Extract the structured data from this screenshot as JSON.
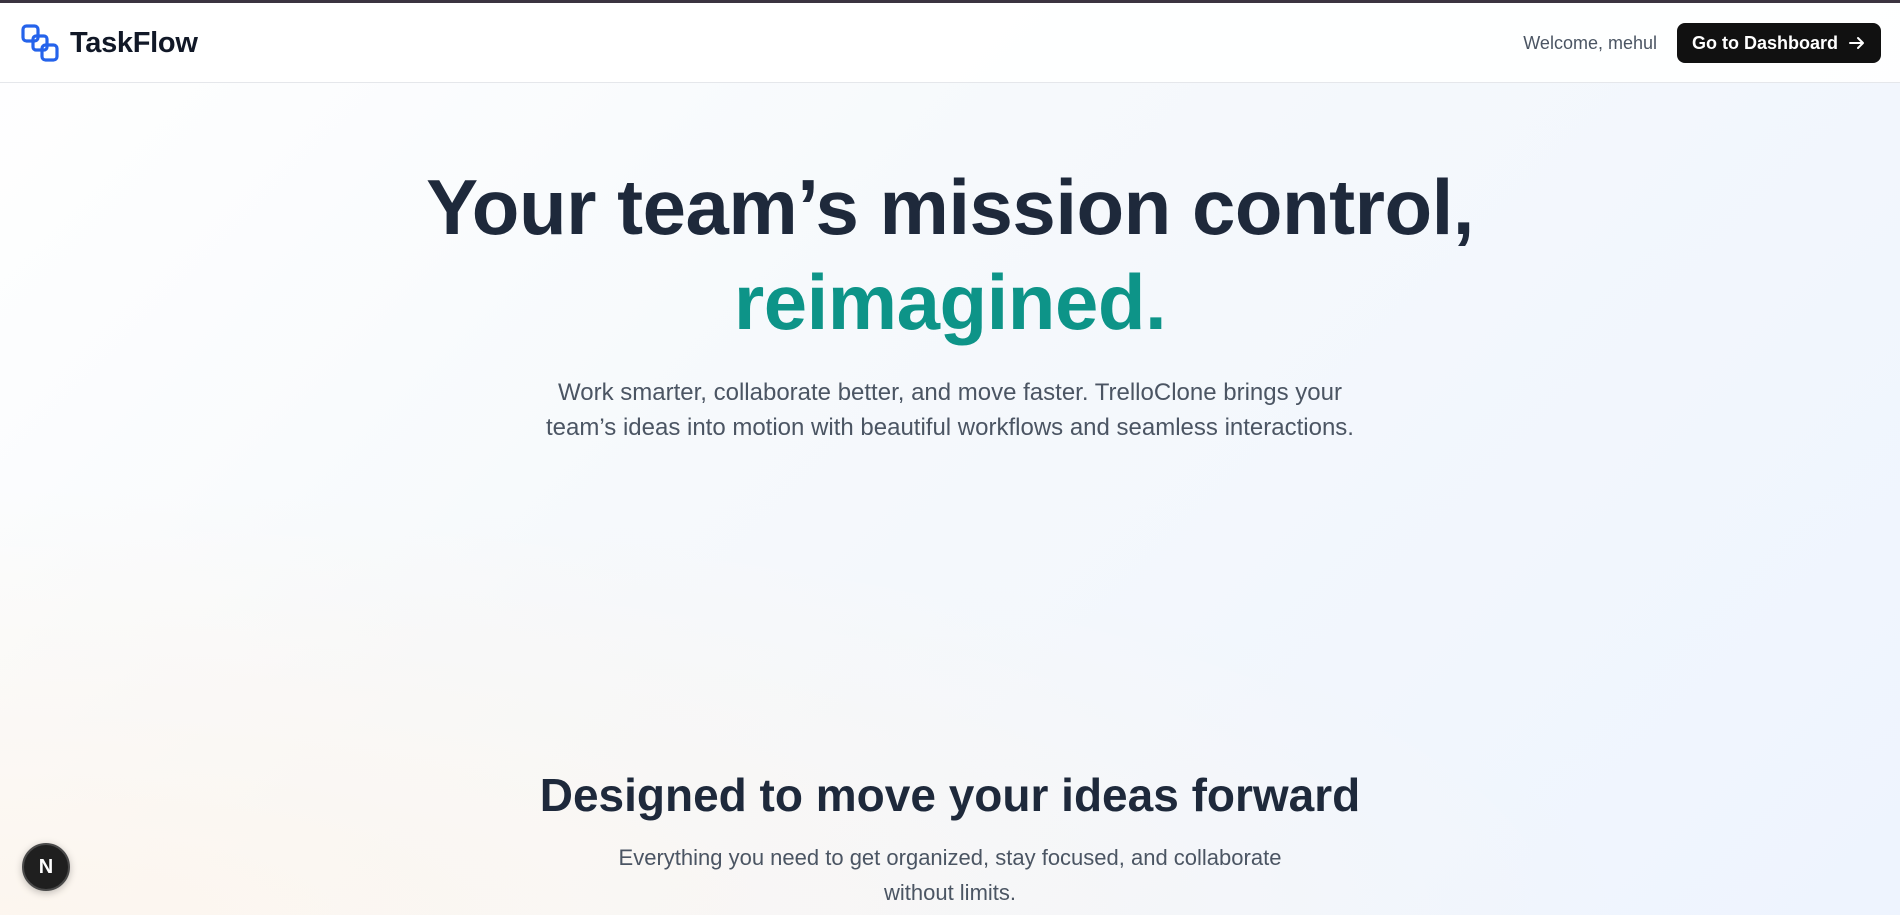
{
  "header": {
    "brand": "TaskFlow",
    "logo_icon": "linked-squares-icon",
    "welcome_text": "Welcome, mehul",
    "dashboard_button_label": "Go to Dashboard",
    "dashboard_button_icon": "arrow-right-icon"
  },
  "hero": {
    "title_line1": "Your team’s mission control,",
    "title_accent": "reimagined.",
    "subtitle": "Work smarter, collaborate better, and move faster. TrelloClone brings your team’s ideas into motion with beautiful workflows and seamless interactions."
  },
  "features": {
    "title": "Designed to move your ideas forward",
    "subtitle": "Everything you need to get organized, stay focused, and collaborate without limits."
  },
  "dev_badge": {
    "label": "N"
  },
  "colors": {
    "accent": "#0d9488",
    "logo_blue": "#2563eb",
    "heading": "#1e293b",
    "button_bg": "#111111"
  }
}
